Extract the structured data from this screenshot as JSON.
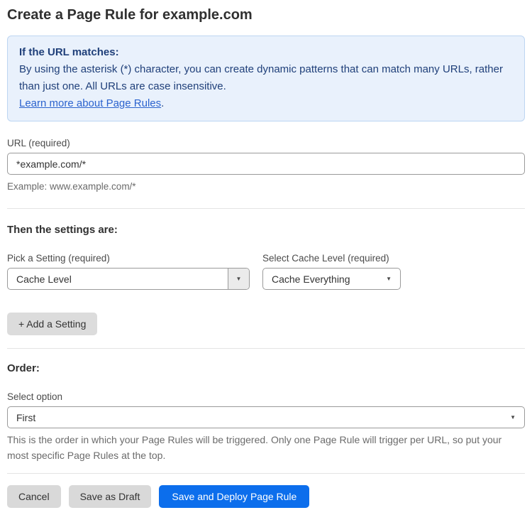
{
  "page": {
    "title": "Create a Page Rule for example.com"
  },
  "info_box": {
    "heading": "If the URL matches:",
    "body": "By using the asterisk (*) character, you can create dynamic patterns that can match many URLs, rather than just one. All URLs are case insensitive.",
    "link_label": "Learn more about Page Rules",
    "link_suffix": "."
  },
  "url_field": {
    "label": "URL (required)",
    "value": "*example.com/*",
    "helper": "Example: www.example.com/*"
  },
  "settings_section": {
    "heading": "Then the settings are:",
    "setting_picker": {
      "label": "Pick a Setting (required)",
      "value": "Cache Level"
    },
    "cache_level": {
      "label": "Select Cache Level (required)",
      "value": "Cache Everything"
    },
    "add_setting_label": "+ Add a Setting"
  },
  "order_section": {
    "heading": "Order:",
    "select_label": "Select option",
    "value": "First",
    "helper": "This is the order in which your Page Rules will be triggered. Only one Page Rule will trigger per URL, so put your most specific Page Rules at the top."
  },
  "actions": {
    "cancel": "Cancel",
    "save_draft": "Save as Draft",
    "save_deploy": "Save and Deploy Page Rule"
  },
  "icons": {
    "dropdown_arrow": "▼"
  },
  "colors": {
    "accent_blue": "#0c6eec",
    "info_bg": "#e9f1fc",
    "info_border": "#bdd6f2",
    "info_text": "#20407a",
    "link_blue": "#2b63ce"
  }
}
